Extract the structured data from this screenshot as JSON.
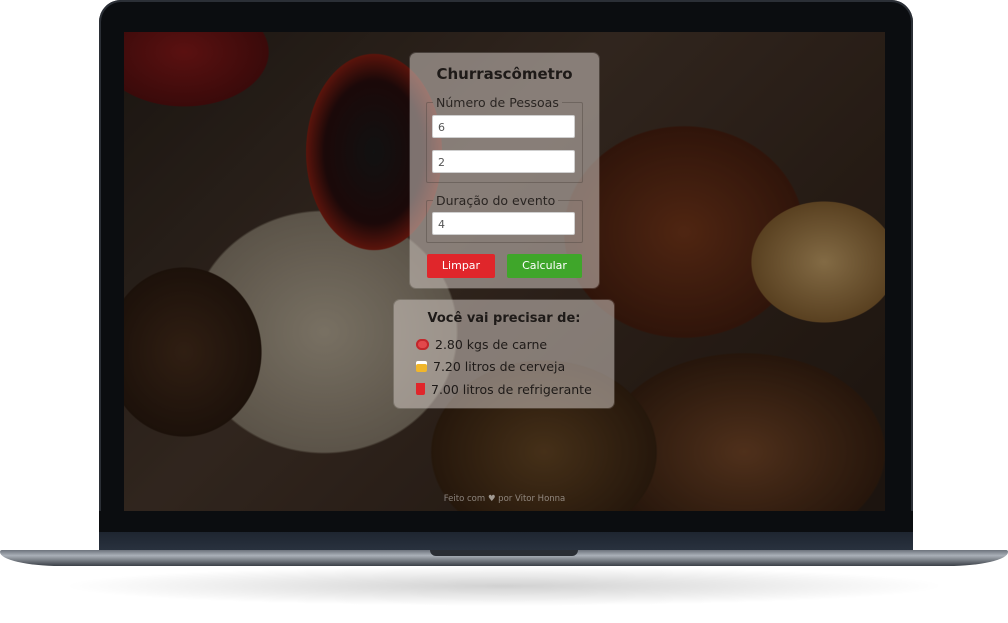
{
  "app": {
    "title": "Churrascômetro"
  },
  "form": {
    "people_legend": "Número de Pessoas",
    "adults_value": "6",
    "children_value": "2",
    "duration_legend": "Duração do evento",
    "duration_value": "4",
    "clear_label": "Limpar",
    "calculate_label": "Calcular"
  },
  "result": {
    "title": "Você vai precisar de:",
    "items": [
      {
        "icon": "meat-icon",
        "text": "2.80 kgs de carne"
      },
      {
        "icon": "beer-icon",
        "text": "7.20 litros de cerveja"
      },
      {
        "icon": "soda-cup-icon",
        "text": "7.00 litros de refrigerante"
      }
    ]
  },
  "footer": {
    "prefix": "Feito com",
    "icon": "heart-icon",
    "suffix": "por Vitor Honna"
  },
  "colors": {
    "clear_button": "#e0262b",
    "calculate_button": "#3fa62a"
  }
}
